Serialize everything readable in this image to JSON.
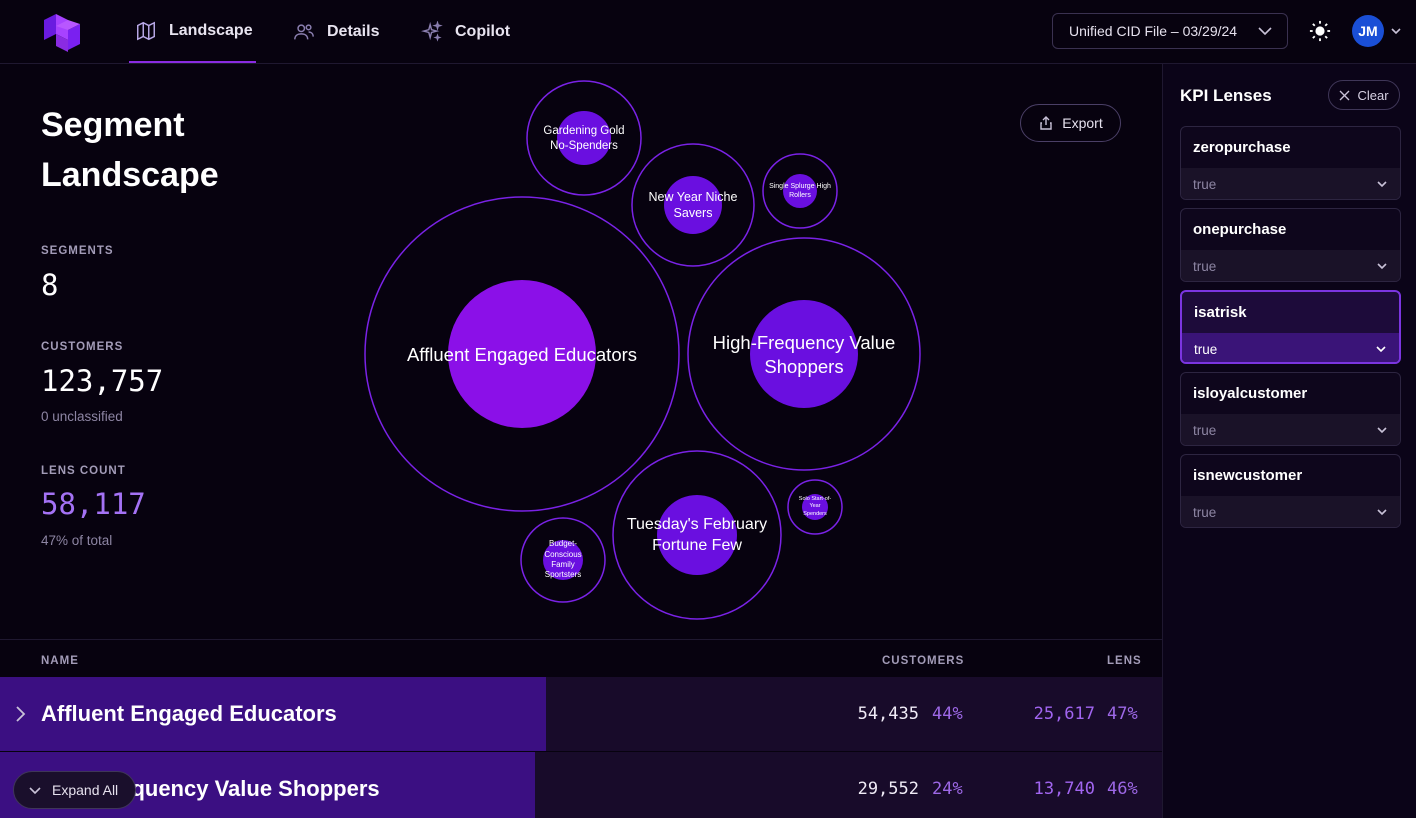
{
  "nav": {
    "tabs": [
      {
        "label": "Landscape",
        "icon": "map-icon",
        "active": true
      },
      {
        "label": "Details",
        "icon": "users-icon",
        "active": false
      },
      {
        "label": "Copilot",
        "icon": "sparkles-icon",
        "active": false
      }
    ],
    "file_select": "Unified CID File – 03/29/24",
    "avatar_initials": "JM"
  },
  "summary": {
    "title_line1": "Segment",
    "title_line2": "Landscape",
    "segments_label": "SEGMENTS",
    "segments_value": "8",
    "customers_label": "CUSTOMERS",
    "customers_value": "123,757",
    "customers_sub": "0 unclassified",
    "lens_label": "LENS COUNT",
    "lens_value": "58,117",
    "lens_sub": "47% of total"
  },
  "export_label": "Export",
  "bubbles": [
    {
      "name": "Affluent Engaged Educators"
    },
    {
      "name": "High-Frequency Value Shoppers"
    },
    {
      "name": "Tuesday's February Fortune Few"
    },
    {
      "name": "Gardening Gold No-Spenders"
    },
    {
      "name": "New Year Niche Savers"
    },
    {
      "name": "Single Splurge High Rollers"
    },
    {
      "name": "Solo Start-of-Year Spenders"
    },
    {
      "name": "Budget-Conscious Family Sportsters"
    }
  ],
  "kpi": {
    "title": "KPI Lenses",
    "clear_label": "Clear",
    "lenses": [
      {
        "name": "zeropurchase",
        "value": "true",
        "selected": false
      },
      {
        "name": "onepurchase",
        "value": "true",
        "selected": false
      },
      {
        "name": "isatrisk",
        "value": "true",
        "selected": true
      },
      {
        "name": "isloyalcustomer",
        "value": "true",
        "selected": false
      },
      {
        "name": "isnewcustomer",
        "value": "true",
        "selected": false
      }
    ]
  },
  "table": {
    "headers": {
      "name": "NAME",
      "customers": "CUSTOMERS",
      "lens": "LENS"
    },
    "rows": [
      {
        "name": "Affluent Engaged Educators",
        "customers": "54,435",
        "customers_pct": "44%",
        "lens": "25,617",
        "lens_pct": "47%",
        "share": 0.47
      },
      {
        "name": "High-Frequency Value Shoppers",
        "customers": "29,552",
        "customers_pct": "24%",
        "lens": "13,740",
        "lens_pct": "46%",
        "share": 0.46
      }
    ],
    "expand_all": "Expand All"
  },
  "colors": {
    "accent": "#8a2be2",
    "bubble_fill": "#8b10e8",
    "bubble_fill_small": "#6a0fe0",
    "background": "#07020f"
  }
}
